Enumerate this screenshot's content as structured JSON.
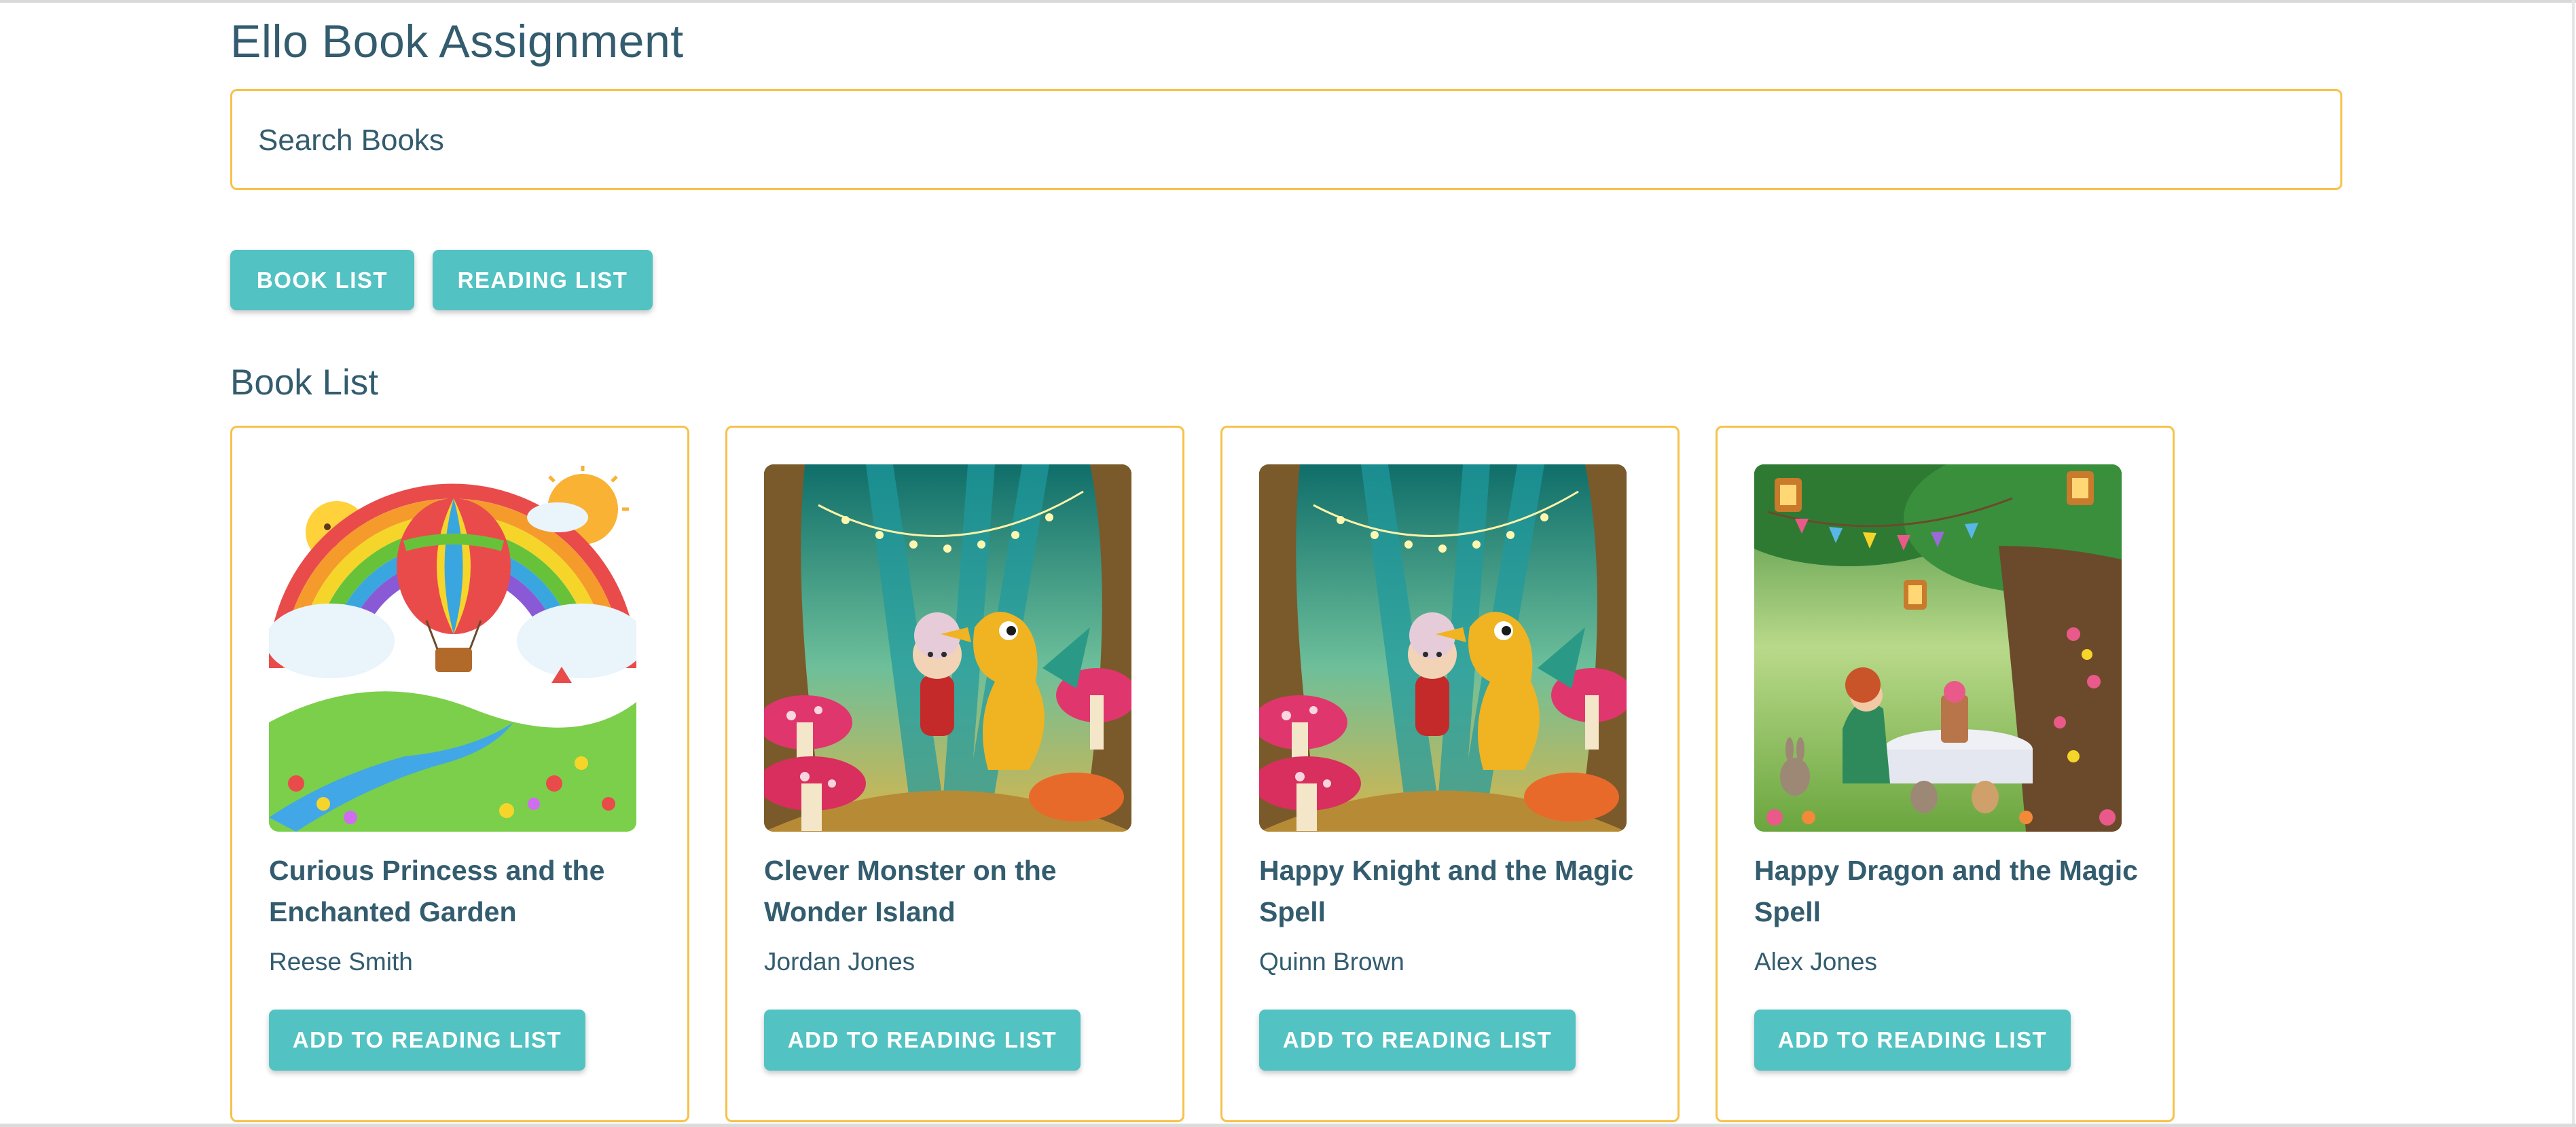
{
  "app": {
    "title": "Ello Book Assignment"
  },
  "search": {
    "placeholder": "Search Books"
  },
  "nav": {
    "book_list_label": "BOOK LIST",
    "reading_list_label": "READING LIST"
  },
  "section": {
    "heading": "Book List"
  },
  "books": [
    {
      "title": "Curious Princess and the Enchanted Garden",
      "author": "Reese Smith",
      "button_label": "ADD TO READING LIST",
      "cover_icon": "rainbow-balloon-cover"
    },
    {
      "title": "Clever Monster on the Wonder Island",
      "author": "Jordan Jones",
      "button_label": "ADD TO READING LIST",
      "cover_icon": "forest-dragon-cover"
    },
    {
      "title": "Happy Knight and the Magic Spell",
      "author": "Quinn Brown",
      "button_label": "ADD TO READING LIST",
      "cover_icon": "forest-dragon-cover"
    },
    {
      "title": "Happy Dragon and the Magic Spell",
      "author": "Alex Jones",
      "button_label": "ADD TO READING LIST",
      "cover_icon": "tea-party-tree-cover"
    }
  ],
  "colors": {
    "accent": "#53c2c3",
    "border": "#f7c24a",
    "text": "#335c6e"
  }
}
